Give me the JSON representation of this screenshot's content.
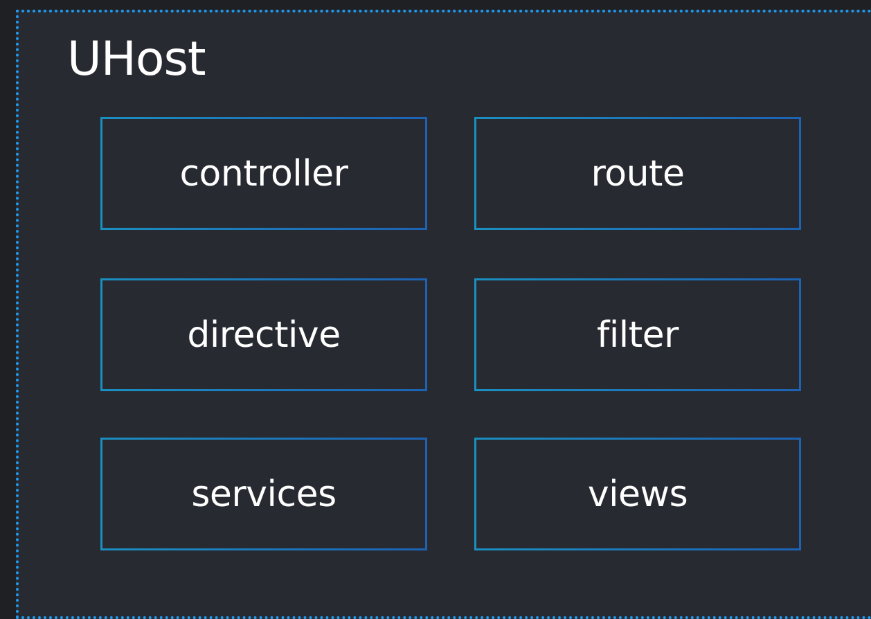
{
  "diagram": {
    "title": "UHost",
    "modules": [
      {
        "label": "controller"
      },
      {
        "label": "route"
      },
      {
        "label": "directive"
      },
      {
        "label": "filter"
      },
      {
        "label": "services"
      },
      {
        "label": "views"
      }
    ]
  },
  "colors": {
    "frame_border": "#1e9bf0",
    "frame_background": "#272a31",
    "page_background": "#1f2024",
    "box_border_start": "#1b8fc0",
    "box_border_end": "#1d62b4",
    "text": "#ffffff"
  }
}
